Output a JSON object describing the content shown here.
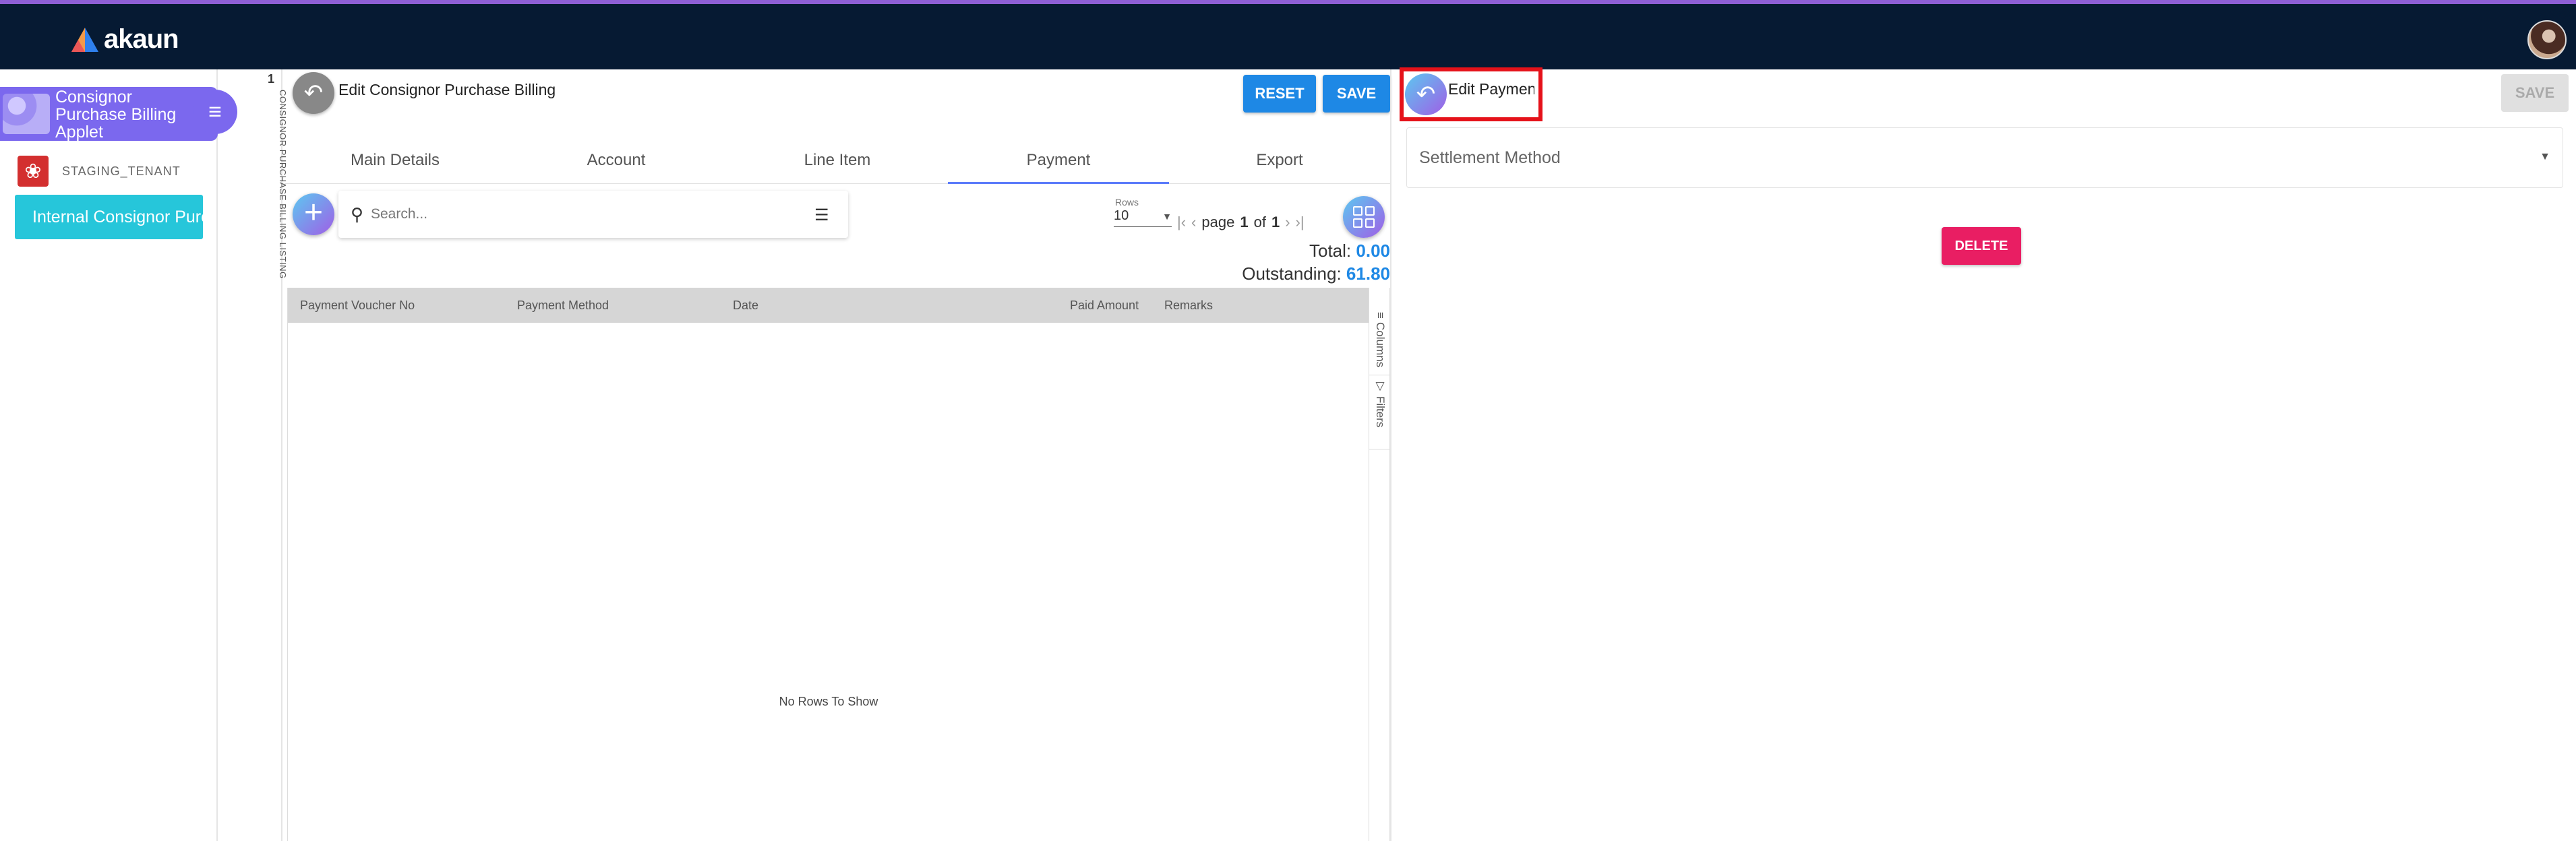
{
  "header": {
    "logo_text": "akaun"
  },
  "sidebar": {
    "applet_title": "Consignor Purchase Billing Applet",
    "tenant_name": "STAGING_TENANT",
    "nav_item": "Internal Consignor Purchase Billing"
  },
  "vertical_tab": {
    "number": "1",
    "label": "CONSIGNOR PURCHASE BILLING LISTING"
  },
  "edit_panel": {
    "title": "Edit Consignor Purchase Billing",
    "reset_label": "RESET",
    "save_label": "SAVE",
    "tabs": [
      "Main Details",
      "Account",
      "Line Item",
      "Payment",
      "Export"
    ],
    "active_tab": "Payment",
    "search_placeholder": "Search...",
    "rows_label": "Rows",
    "rows_value": "10",
    "pager": {
      "page_word": "page",
      "page": "1",
      "of_word": "of",
      "total_pages": "1"
    },
    "total_label": "Total:",
    "total_value": "0.00",
    "outstanding_label": "Outstanding:",
    "outstanding_value": "61.80",
    "columns": [
      "Payment Voucher No",
      "Payment Method",
      "Date",
      "Paid Amount",
      "Remarks"
    ],
    "empty_message": "No Rows To Show",
    "side_tools": [
      "Columns",
      "Filters"
    ]
  },
  "payment_panel": {
    "title": "Edit Payment",
    "save_label": "SAVE",
    "settlement_label": "Settlement Method",
    "delete_label": "DELETE"
  },
  "colors": {
    "topbar": "#061a33",
    "accent_purple": "#7b68ee",
    "primary_blue": "#1e88e5",
    "delete_pink": "#e91e63",
    "highlight_red": "#e5121a"
  }
}
